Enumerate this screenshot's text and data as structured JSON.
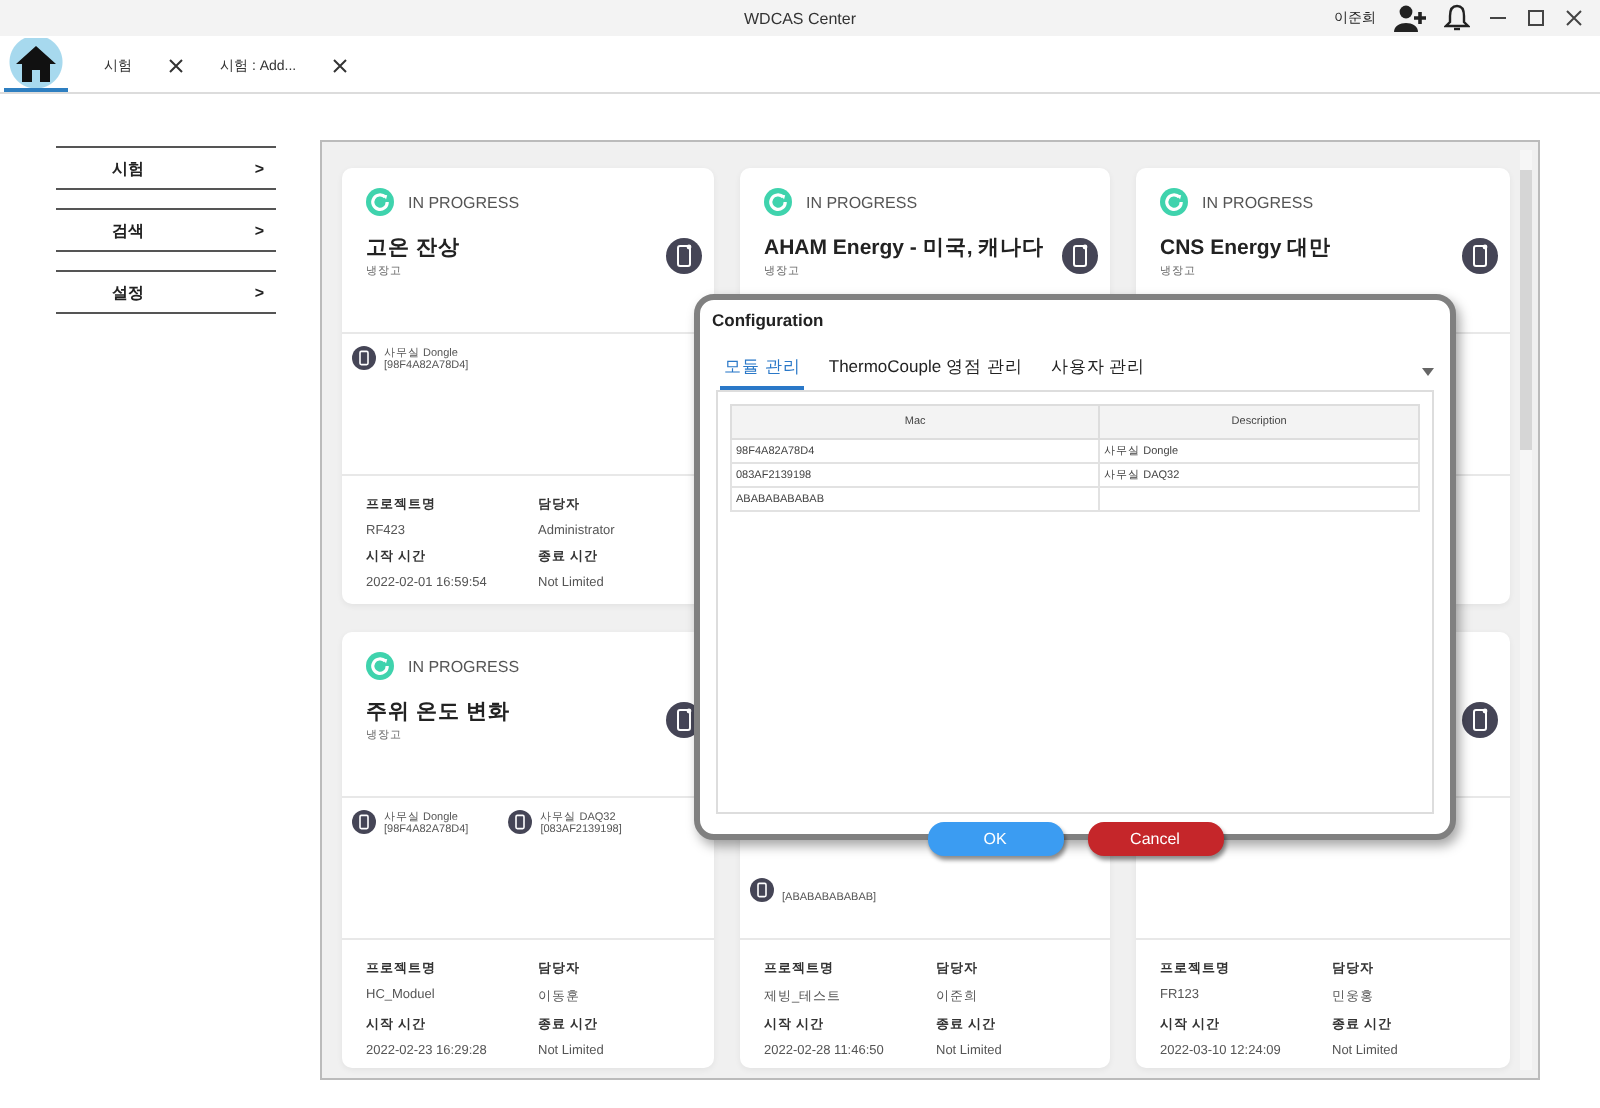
{
  "window": {
    "title": "WDCAS Center",
    "user": "이준희"
  },
  "home_tab": {
    "selected": true
  },
  "tabs": [
    {
      "label": "시험",
      "selected": false
    },
    {
      "label": "시험 : Add...",
      "selected": false
    }
  ],
  "sidebar": {
    "items": [
      {
        "label": "시험",
        "arrow": ">"
      },
      {
        "label": "검색",
        "arrow": ">"
      },
      {
        "label": "설정",
        "arrow": ">"
      }
    ]
  },
  "cards": [
    {
      "status": "IN PROGRESS",
      "title": "고온 잔상",
      "subtitle": "냉장고",
      "device_icon": true,
      "devices": [
        {
          "name": "사무실 Dongle",
          "mac": "[98F4A82A78D4]"
        }
      ],
      "details": [
        {
          "label": "프로젝트명",
          "value": "RF423"
        },
        {
          "label": "담당자",
          "value": "Administrator"
        },
        {
          "label": "시작 시간",
          "value": "2022-02-01 16:59:54"
        },
        {
          "label": "종료 시간",
          "value": "Not Limited"
        }
      ]
    },
    {
      "status": "IN PROGRESS",
      "title": "AHAM Energy - 미국, 캐나다",
      "subtitle": "냉장고",
      "device_icon": true
    },
    {
      "status": "IN PROGRESS",
      "title": "CNS Energy 대만",
      "subtitle": "냉장고",
      "device_icon": true
    },
    {
      "status": "IN PROGRESS",
      "title": "주위 온도 변화",
      "subtitle": "냉장고",
      "device_icon": true,
      "devices": [
        {
          "name": "사무실 Dongle",
          "mac": "[98F4A82A78D4]"
        },
        {
          "name": "사무실 DAQ32",
          "mac": "[083AF2139198]"
        }
      ],
      "details": [
        {
          "label": "프로젝트명",
          "value": "HC_Moduel"
        },
        {
          "label": "담당자",
          "value": "이동훈"
        },
        {
          "label": "시작 시간",
          "value": "2022-02-23 16:29:28"
        },
        {
          "label": "종료 시간",
          "value": "Not Limited"
        }
      ]
    },
    {
      "devices": [
        {
          "mac": "[ABABABABABAB]"
        }
      ],
      "details": [
        {
          "label": "프로젝트명",
          "value": "제빙_테스트"
        },
        {
          "label": "담당자",
          "value": "이준희"
        },
        {
          "label": "시작 시간",
          "value": "2022-02-28 11:46:50"
        },
        {
          "label": "종료 시간",
          "value": "Not Limited"
        }
      ]
    },
    {
      "device_icon": true,
      "details": [
        {
          "label": "프로젝트명",
          "value": "FR123"
        },
        {
          "label": "담당자",
          "value": "민웅홍"
        },
        {
          "label": "시작 시간",
          "value": "2022-03-10 12:24:09"
        },
        {
          "label": "종료 시간",
          "value": "Not Limited"
        }
      ]
    }
  ],
  "dialog": {
    "title": "Configuration",
    "tabs": [
      {
        "label": "모듈 관리",
        "selected": true
      },
      {
        "label": "ThermoCouple 영점 관리",
        "selected": false
      },
      {
        "label": "사용자 관리",
        "selected": false
      }
    ],
    "table": {
      "columns": [
        "Mac",
        "Description"
      ],
      "rows": [
        [
          "98F4A82A78D4",
          "사무실 Dongle"
        ],
        [
          "083AF2139198",
          "사무실 DAQ32"
        ],
        [
          "ABABABABABAB"
        ]
      ]
    },
    "buttons": [
      {
        "label": "OK",
        "kind": "ok"
      },
      {
        "label": "Cancel",
        "kind": "cancel"
      }
    ]
  }
}
